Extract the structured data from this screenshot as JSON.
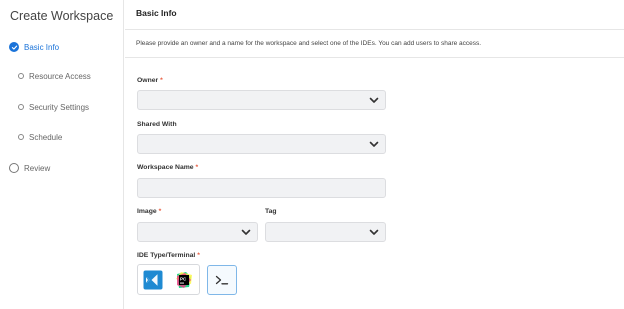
{
  "sidebar": {
    "title": "Create Workspace",
    "steps": [
      {
        "label": "Basic Info",
        "state": "active"
      },
      {
        "label": "Resource Access",
        "state": "sub"
      },
      {
        "label": "Security Settings",
        "state": "sub"
      },
      {
        "label": "Schedule",
        "state": "sub"
      },
      {
        "label": "Review",
        "state": "pending"
      }
    ]
  },
  "header": {
    "title": "Basic Info",
    "description": "Please provide an owner and a name for the workspace and select one of the IDEs. You can add users to share access."
  },
  "form": {
    "owner_label": "Owner",
    "shared_with_label": "Shared With",
    "workspace_name_label": "Workspace Name",
    "image_label": "Image",
    "tag_label": "Tag",
    "ide_label": "IDE Type/Terminal",
    "required_marker": "*"
  },
  "ide_options": [
    {
      "icon": "vscode-icon",
      "selected": false
    },
    {
      "icon": "pycharm-icon",
      "selected": false
    },
    {
      "icon": "terminal-icon",
      "selected": true
    }
  ],
  "colors": {
    "accent": "#1a73d9",
    "required": "#e8593c",
    "field_bg": "#f1f2f4"
  }
}
